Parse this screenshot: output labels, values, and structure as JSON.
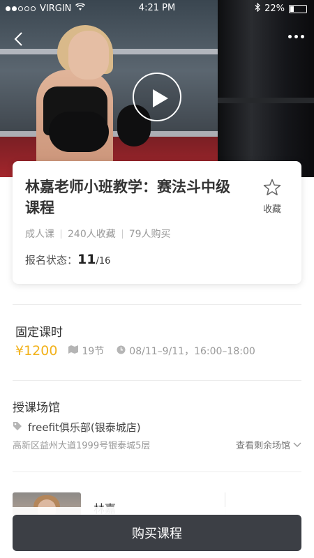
{
  "status_bar": {
    "carrier": "VIRGIN",
    "time": "4:21 PM",
    "battery": "22%",
    "battery_level": 0.22,
    "signal_bars_filled": 2,
    "icons": [
      "wifi-icon",
      "bluetooth-icon",
      "battery-icon"
    ]
  },
  "hero": {
    "icons": [
      "back-chevron-icon",
      "more-dots-icon",
      "play-icon"
    ]
  },
  "course": {
    "title": "林嘉老师小班教学：赛法斗中级课程",
    "favorite_label": "收藏",
    "tags": [
      "成人课",
      "240人收藏",
      "79人购买"
    ],
    "enroll_label": "报名状态：",
    "enroll_current": "11",
    "enroll_total": "/16"
  },
  "schedule": {
    "section_title": "固定课时",
    "price": "¥1200",
    "lessons": "19节",
    "time": "08/11–9/11，16:00–18:00"
  },
  "venue": {
    "section_title": "授课场馆",
    "name": "freefit俱乐部(银泰城店)",
    "address": "高新区益州大道1999号银泰城5层",
    "more_label": "查看剩余场馆"
  },
  "teacher": {
    "name": "林嘉"
  },
  "bottom": {
    "buy_label": "购买课程"
  },
  "colors": {
    "accent_price": "#f2b21c",
    "button_bg": "#3c3f45"
  }
}
